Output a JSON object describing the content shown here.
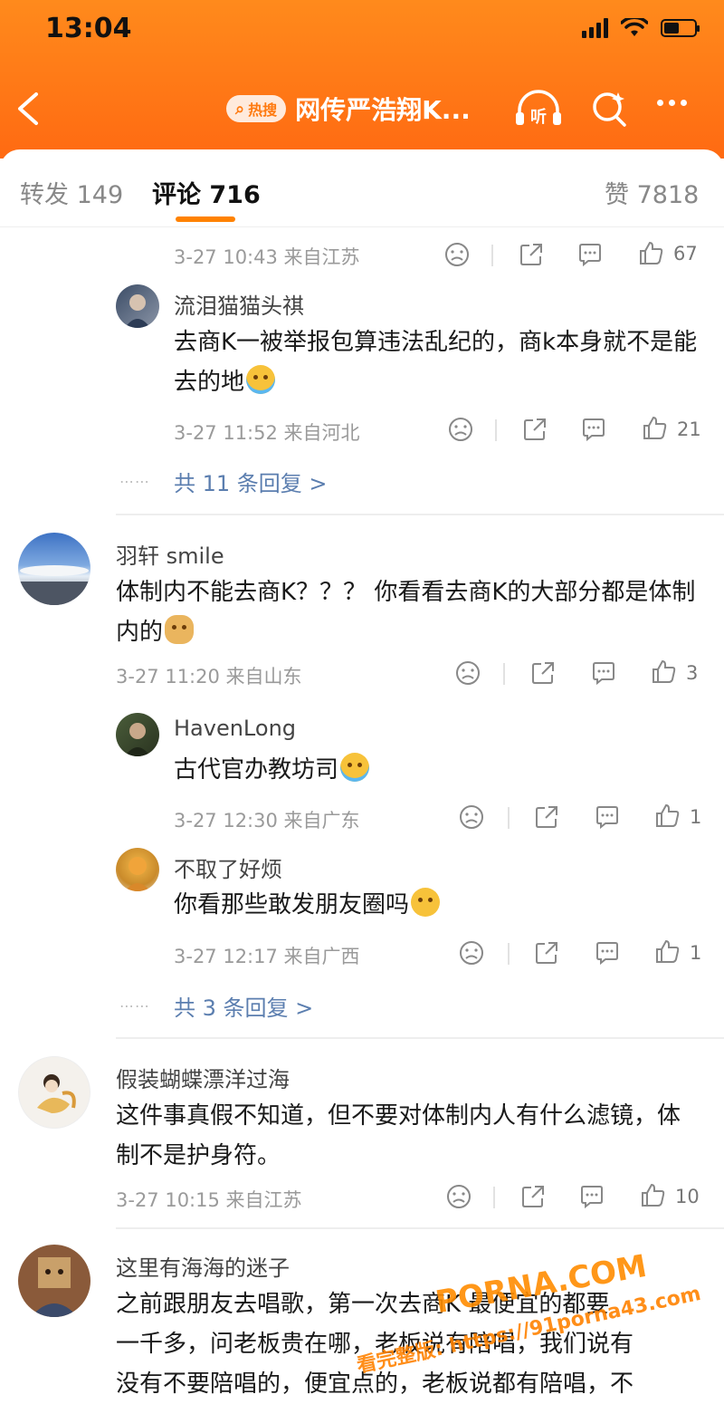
{
  "status_bar": {
    "time": "13:04"
  },
  "nav": {
    "hot_label": "热搜",
    "title": "网传严浩翔K...",
    "listen_label": "听"
  },
  "tabs": [
    {
      "label": "转发 149"
    },
    {
      "label": "评论 716"
    },
    {
      "label": "赞 7818"
    }
  ],
  "comments": [
    {
      "meta": "3-27 10:43 来自江苏",
      "likes": "67"
    },
    {
      "username": "流泪猫猫头祺",
      "text": "去商K一被举报包算违法乱纪的，商k本身就不是能去的地",
      "meta": "3-27 11:52 来自河北",
      "likes": "21"
    },
    {
      "more_replies": "共 11 条回复 >"
    },
    {
      "username": "羽轩 smile",
      "text": "体制内不能去商K？？？ 你看看去商K的大部分都是体制内的",
      "meta": "3-27 11:20 来自山东",
      "likes": "3"
    },
    {
      "username": "HavenLong",
      "text": "古代官办教坊司",
      "meta": "3-27 12:30 来自广东",
      "likes": "1"
    },
    {
      "username": "不取了好烦",
      "text": "你看那些敢发朋友圈吗",
      "meta": "3-27 12:17 来自广西",
      "likes": "1"
    },
    {
      "more_replies": "共 3 条回复 >"
    },
    {
      "username": "假装蝴蝶漂洋过海",
      "text": "这件事真假不知道，但不要对体制内人有什么滤镜，体制不是护身符。",
      "meta": "3-27 10:15 来自江苏",
      "likes": "10"
    },
    {
      "username": "这里有海海的迷子",
      "text_lines": [
        "之前跟朋友去唱歌，第一次去商K 最便宜的都要",
        "一千多，问老板贵在哪，老板说有陪唱，我们说有",
        "没有不要陪唱的，便宜点的，老板说都有陪唱，不"
      ]
    }
  ],
  "watermark": {
    "line1": "PORNA.COM",
    "line2": "看完整版: https://91porna43.com"
  }
}
